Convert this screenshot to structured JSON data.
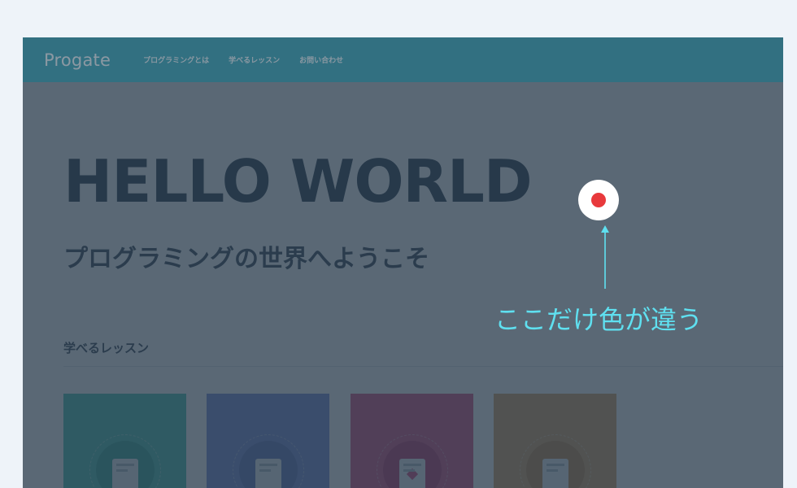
{
  "navbar": {
    "logo": "Progate",
    "links": [
      "プログラミングとは",
      "学べるレッスン",
      "お問い合わせ"
    ]
  },
  "hero": {
    "title": "HELLO WORLD",
    "subtitle": "プログラミングの世界へようこそ"
  },
  "lessons": {
    "section_title": "学べるレッスン",
    "cards": [
      {
        "icon": "browser-icon",
        "color": "#4ec6b4",
        "circle_color": "#37ad9c"
      },
      {
        "icon": "device-icon",
        "color": "#7b8fd8",
        "circle_color": "#6478c2"
      },
      {
        "icon": "ruby-icon",
        "color": "#d75487",
        "circle_color": "#c03d72"
      },
      {
        "icon": "device-icon",
        "color": "#d9a468",
        "circle_color": "#c48c4f"
      }
    ]
  },
  "annotation": {
    "text": "ここだけ色が違う",
    "color": "#5fe0f0",
    "dot_color": "#e8393c"
  },
  "colors": {
    "navbar": "#3ea8b8",
    "overlay": "#26384a",
    "page_bg": "#eef3f9"
  }
}
